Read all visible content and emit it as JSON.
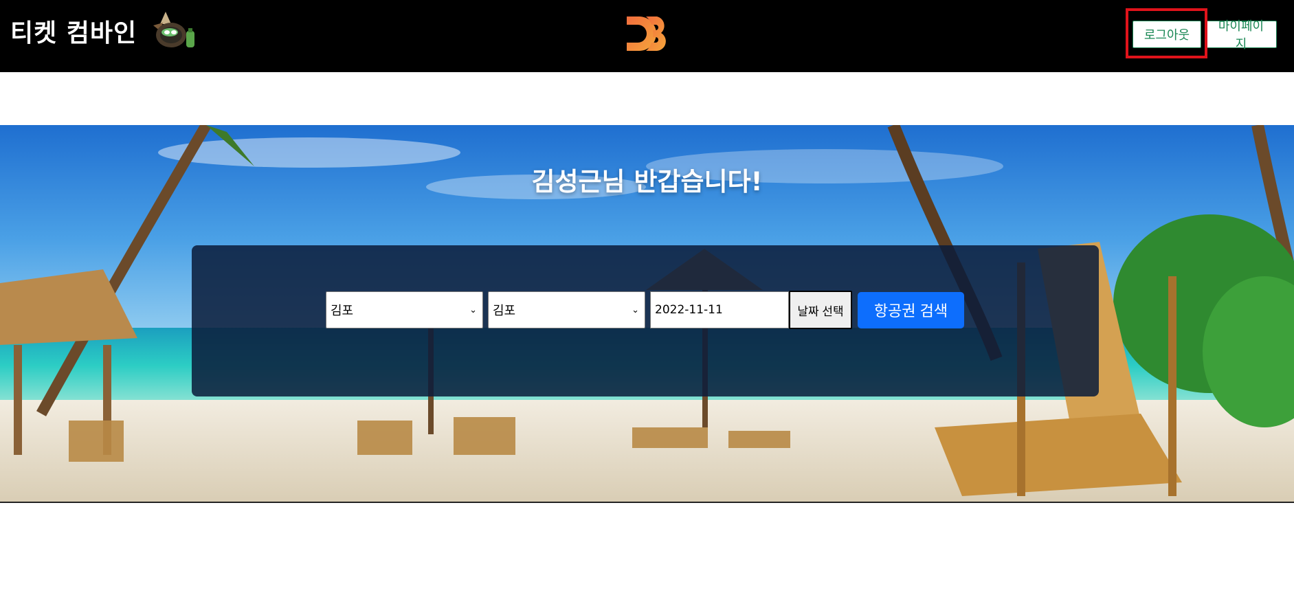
{
  "header": {
    "brand": "티켓 컴바인",
    "mascot_icon": "goblin-mascot-icon",
    "center_logo_icon": "d3-logo-icon",
    "logout_label": "로그아웃",
    "mypage_label": "마이페이지",
    "accent_color": "#198754",
    "highlight_color": "#e0131b"
  },
  "hero": {
    "greeting": "김성근님 반갑습니다!",
    "background": "tropical-beach-image"
  },
  "search": {
    "departure": "김포",
    "arrival": "김포",
    "date": "2022-11-11",
    "date_button": "날짜 선택",
    "search_button": "항공권 검색",
    "search_button_color": "#0d6efd"
  }
}
